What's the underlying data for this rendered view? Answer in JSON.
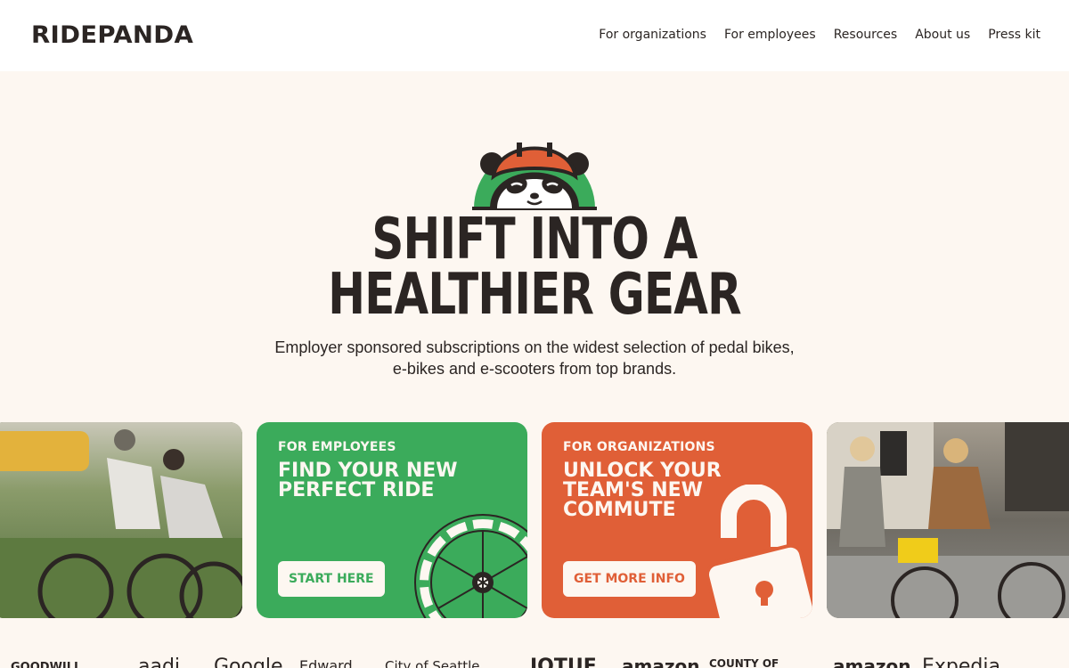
{
  "brand": {
    "logo_text": "RIDEPANDA"
  },
  "nav": {
    "items": [
      {
        "label": "For organizations"
      },
      {
        "label": "For employees"
      },
      {
        "label": "Resources"
      },
      {
        "label": "About us"
      },
      {
        "label": "Press kit"
      }
    ]
  },
  "hero": {
    "headline_line1": "SHIFT INTO A",
    "headline_line2": "HEALTHIER GEAR",
    "subtitle": "Employer sponsored subscriptions on the widest selection of pedal bikes, e-bikes and e-scooters from top brands."
  },
  "cards": {
    "employees": {
      "kicker": "FOR EMPLOYEES",
      "title": "FIND YOUR NEW PERFECT RIDE",
      "button": "START HERE",
      "color": "#3bab5b"
    },
    "organizations": {
      "kicker": "FOR ORGANIZATIONS",
      "title": "UNLOCK YOUR TEAM'S NEW COMMUTE",
      "button": "GET MORE INFO",
      "color": "#e05f37"
    }
  },
  "logos_strip": {
    "items": [
      "GOODWILL",
      "aadi",
      "Google",
      "Edward",
      "City of Seattle",
      "IOTUE",
      "amazon",
      "COUNTY OF",
      "amazon",
      "Expedia"
    ]
  },
  "colors": {
    "background": "#fdf7f1",
    "text": "#2b2523",
    "green": "#3bab5b",
    "orange": "#e05f37"
  }
}
